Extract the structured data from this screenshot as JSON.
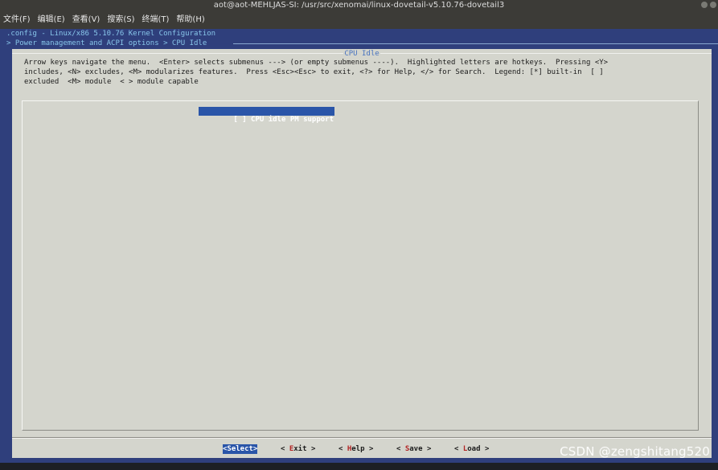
{
  "window": {
    "title": "aot@aot-MEHLJAS-SI: /usr/src/xenomai/linux-dovetail-v5.10.76-dovetail3"
  },
  "menubar": {
    "items": [
      "文件(F)",
      "编辑(E)",
      "查看(V)",
      "搜索(S)",
      "终端(T)",
      "帮助(H)"
    ]
  },
  "terminal": {
    "config_line": ".config - Linux/x86 5.10.76 Kernel Configuration",
    "breadcrumb": "> Power management and ACPI options > CPU Idle"
  },
  "dialog": {
    "title": "CPU Idle",
    "help_text": "Arrow keys navigate the menu.  <Enter> selects submenus ---> (or empty submenus ----).  Highlighted letters are hotkeys.  Pressing <Y>\nincludes, <N> excludes, <M> modularizes features.  Press <Esc><Esc> to exit, <?> for Help, </> for Search.  Legend: [*] built-in  [ ]\nexcluded  <M> module  < > module capable",
    "menu_items": [
      {
        "checkbox": "[ ]",
        "label": "CPU idle PM support",
        "selected": true
      }
    ],
    "buttons": [
      {
        "pre": "<",
        "hot": "S",
        "rest": "elect>",
        "selected": true
      },
      {
        "pre": "< ",
        "hot": "E",
        "rest": "xit >",
        "selected": false
      },
      {
        "pre": "< ",
        "hot": "H",
        "rest": "elp >",
        "selected": false
      },
      {
        "pre": "< ",
        "hot": "S",
        "rest": "ave >",
        "selected": false
      },
      {
        "pre": "< ",
        "hot": "L",
        "rest": "oad >",
        "selected": false
      }
    ]
  },
  "watermark": "CSDN @zengshitang520"
}
